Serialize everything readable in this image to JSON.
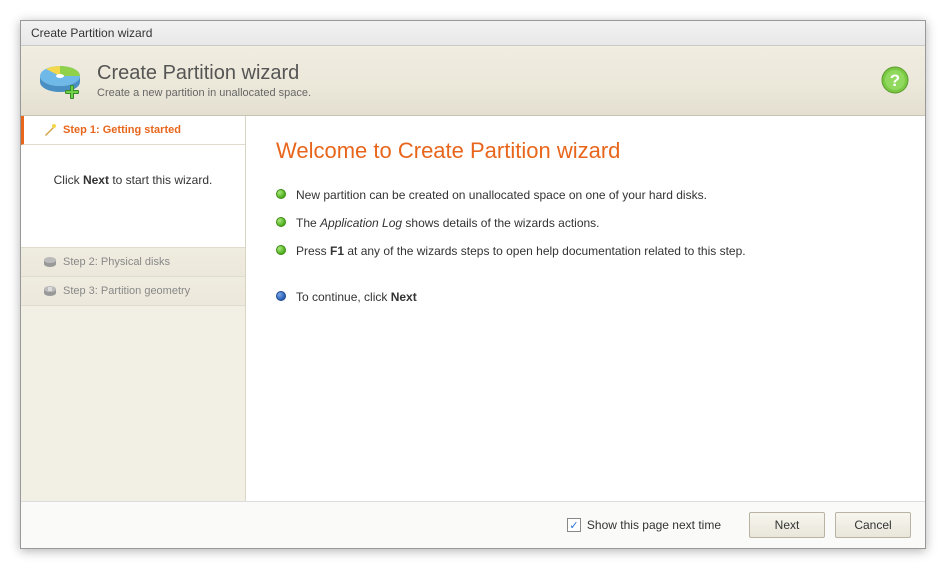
{
  "window": {
    "title": "Create Partition wizard"
  },
  "header": {
    "title": "Create Partition wizard",
    "subtitle": "Create a new partition in unallocated space."
  },
  "sidebar": {
    "steps": [
      {
        "label": "Step 1: Getting started",
        "active": true
      },
      {
        "label": "Step 2: Physical disks",
        "active": false
      },
      {
        "label": "Step 3: Partition geometry",
        "active": false
      }
    ],
    "hint_prefix": "Click ",
    "hint_bold": "Next",
    "hint_suffix": " to start this wizard."
  },
  "main": {
    "title": "Welcome to Create Partition wizard",
    "bullets": [
      {
        "color": "green",
        "text": "New partition can be created on unallocated space on one of your hard disks."
      },
      {
        "color": "green",
        "html": "The <em>Application Log</em> shows details of the wizards actions."
      },
      {
        "color": "green",
        "html": "Press <b>F1</b> at any of the wizards steps to open help documentation related to this step."
      }
    ],
    "continue": {
      "color": "blue",
      "html": "To continue, click <b>Next</b>"
    }
  },
  "footer": {
    "checkbox_label": "Show this page next time",
    "checkbox_checked": true,
    "next": "Next",
    "cancel": "Cancel"
  }
}
